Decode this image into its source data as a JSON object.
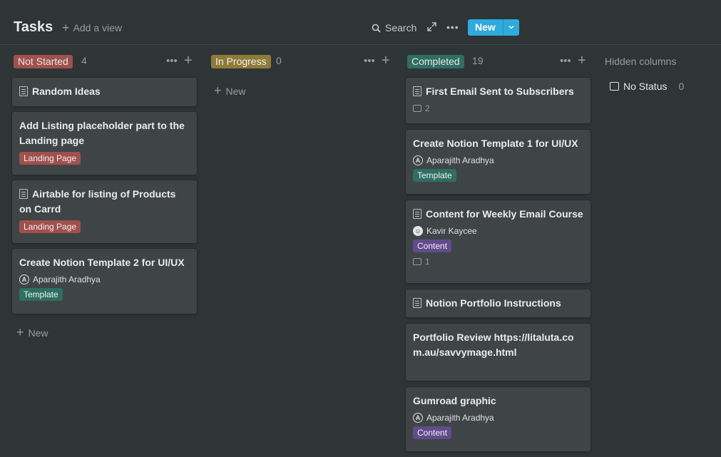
{
  "header": {
    "title": "Tasks",
    "add_view": "Add a view",
    "search": "Search",
    "new": "New"
  },
  "columns": [
    {
      "label": "Not Started",
      "count": "4",
      "color": "#a0504d",
      "cards": [
        {
          "title": "Random Ideas"
        },
        {
          "title": "Add Listing placeholder part to the Landing page",
          "tag": "Landing Page"
        },
        {
          "title": "Airtable for listing of Products on Carrd",
          "tag": "Landing Page"
        },
        {
          "title": "Create Notion Template 2 for UI/UX",
          "person": "Aparajith Aradhya",
          "tag": "Template"
        }
      ],
      "add": "New"
    },
    {
      "label": "In Progress",
      "count": "0",
      "color": "#8e7b36",
      "add": "New"
    },
    {
      "label": "Completed",
      "count": "19",
      "color": "#2f6e62",
      "cards": [
        {
          "title": "First Email Sent to Subscribers",
          "comments": "2"
        },
        {
          "title": "Create Notion Template 1 for UI/UX",
          "person": "Aparajith Aradhya",
          "tag": "Template"
        },
        {
          "title": "Content for Weekly Email Course",
          "person": "Kavir Kaycee",
          "tag": "Content",
          "comments": "1"
        },
        {
          "title": "Notion Portfolio Instructions"
        },
        {
          "title": "Portfolio Review https://litaluta.com.au/savvymage.html"
        },
        {
          "title": "Gumroad graphic",
          "person": "Aparajith Aradhya",
          "tag": "Content"
        }
      ]
    }
  ],
  "hidden": {
    "title": "Hidden columns",
    "no_status": "No Status",
    "no_status_count": "0"
  },
  "icons": [
    "plus-icon",
    "search-icon",
    "expand-icon",
    "more-icon",
    "chevron-down-icon",
    "page-icon",
    "comment-icon",
    "avatar-icon",
    "inbox-icon"
  ]
}
